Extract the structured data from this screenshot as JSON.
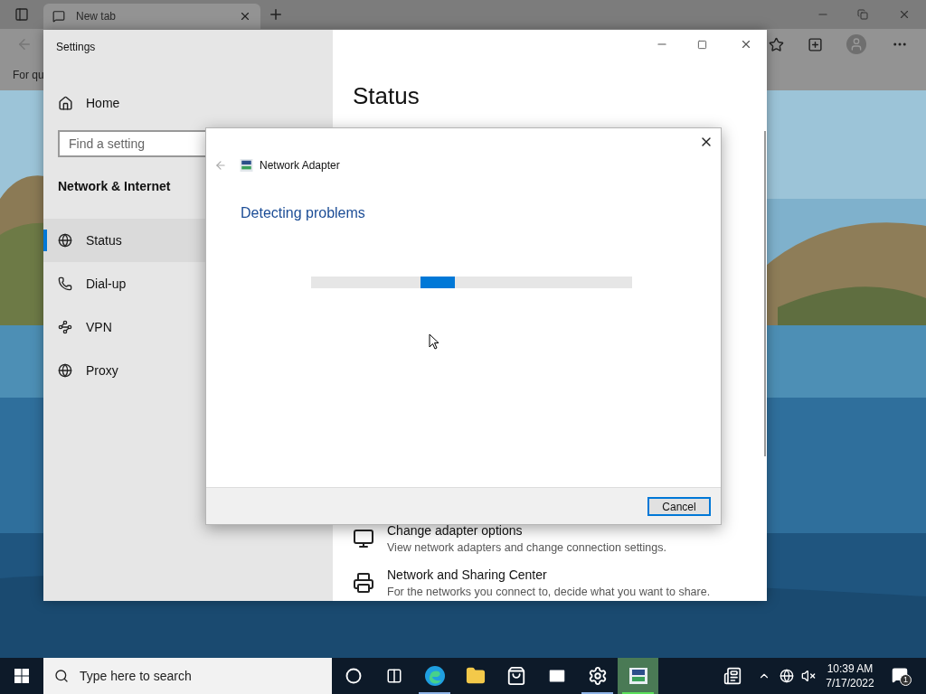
{
  "browser": {
    "tabs": [
      {
        "title": "New tab",
        "selected": true
      }
    ],
    "favorites_bar_text": "For qu"
  },
  "settings": {
    "title": "Settings",
    "home": "Home",
    "search": {
      "placeholder": "Find a setting"
    },
    "section": "Network & Internet",
    "nav": [
      {
        "label": "Status",
        "selected": true
      },
      {
        "label": "Dial-up",
        "selected": false
      },
      {
        "label": "VPN",
        "selected": false
      },
      {
        "label": "Proxy",
        "selected": false
      }
    ],
    "heading": "Status",
    "links": [
      {
        "title": "Change adapter options",
        "description": "View network adapters and change connection settings."
      },
      {
        "title": "Network and Sharing Center",
        "description": "For the networks you connect to, decide what you want to share."
      }
    ]
  },
  "dialog": {
    "app_title": "Network Adapter",
    "status": "Detecting problems",
    "progress": {
      "indeterminate": true
    },
    "buttons": [
      {
        "label": "Cancel",
        "default": true
      }
    ]
  },
  "taskbar": {
    "search_placeholder": "Type here to search",
    "apps": [
      {
        "running": false,
        "active": false
      },
      {
        "running": false,
        "active": false
      },
      {
        "running": true,
        "active": false
      },
      {
        "running": false,
        "active": false
      },
      {
        "running": false,
        "active": false
      },
      {
        "running": false,
        "active": false
      },
      {
        "running": true,
        "active": false
      },
      {
        "running": true,
        "active": true
      }
    ],
    "time": "10:39 AM",
    "date": "7/17/2022",
    "notification_count": "1"
  }
}
